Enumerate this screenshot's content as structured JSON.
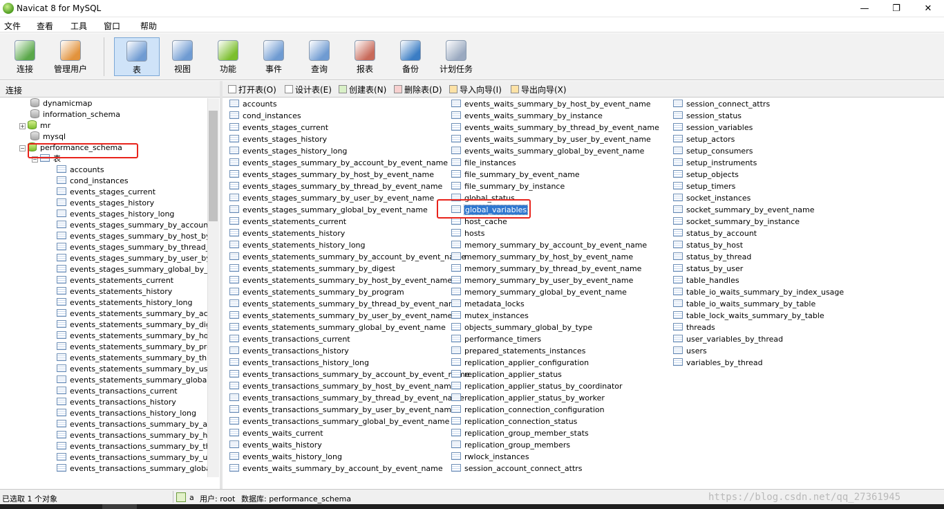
{
  "window": {
    "title": "Navicat 8 for MySQL",
    "min": "—",
    "max": "❐",
    "close": "✕"
  },
  "menu": [
    "文件",
    "查看",
    "工具",
    "窗口",
    "帮助"
  ],
  "toolbar": [
    {
      "label": "连接",
      "icon": "connection-icon",
      "color": "#5aa84a"
    },
    {
      "label": "管理用户",
      "icon": "user-icon",
      "color": "#e2933d"
    },
    {
      "label": "表",
      "icon": "table-icon",
      "color": "#6f9bd2",
      "active": true
    },
    {
      "label": "视图",
      "icon": "view-icon",
      "color": "#6f9bd2"
    },
    {
      "label": "功能",
      "icon": "function-icon",
      "color": "#7cbf2e"
    },
    {
      "label": "事件",
      "icon": "event-icon",
      "color": "#6f9bd2"
    },
    {
      "label": "查询",
      "icon": "query-icon",
      "color": "#6f9bd2"
    },
    {
      "label": "报表",
      "icon": "report-icon",
      "color": "#c86a5a"
    },
    {
      "label": "备份",
      "icon": "backup-icon",
      "color": "#3b7dc4"
    },
    {
      "label": "计划任务",
      "icon": "schedule-icon",
      "color": "#9aa9c0"
    }
  ],
  "left_panel": {
    "header": "连接",
    "databases": [
      {
        "name": "dynamicmap",
        "state": "closed"
      },
      {
        "name": "information_schema",
        "state": "closed"
      },
      {
        "name": "mr",
        "state": "open-collapsed"
      },
      {
        "name": "mysql",
        "state": "closed"
      },
      {
        "name": "performance_schema",
        "state": "open-expanded"
      }
    ],
    "group_label": "表",
    "tables": [
      "accounts",
      "cond_instances",
      "events_stages_current",
      "events_stages_history",
      "events_stages_history_long",
      "events_stages_summary_by_account_by",
      "events_stages_summary_by_host_by_ev",
      "events_stages_summary_by_thread_by_",
      "events_stages_summary_by_user_by_ev",
      "events_stages_summary_global_by_even",
      "events_statements_current",
      "events_statements_history",
      "events_statements_history_long",
      "events_statements_summary_by_accour",
      "events_statements_summary_by_digest",
      "events_statements_summary_by_host_b",
      "events_statements_summary_by_progra",
      "events_statements_summary_by_thread",
      "events_statements_summary_by_user_b",
      "events_statements_summary_global_by_",
      "events_transactions_current",
      "events_transactions_history",
      "events_transactions_history_long",
      "events_transactions_summary_by_accou",
      "events_transactions_summary_by_host_",
      "events_transactions_summary_by_threa",
      "events_transactions_summary_by_user_",
      "events_transactions_summary_global_by"
    ]
  },
  "right_toolbar": [
    {
      "label": "打开表(O)",
      "icon": "open-table-icon",
      "variant": ""
    },
    {
      "label": "设计表(E)",
      "icon": "design-table-icon",
      "variant": ""
    },
    {
      "label": "创建表(N)",
      "icon": "create-table-icon",
      "variant": "green"
    },
    {
      "label": "删除表(D)",
      "icon": "delete-table-icon",
      "variant": "red"
    },
    {
      "label": "导入向导(I)",
      "icon": "import-wizard-icon",
      "variant": "up"
    },
    {
      "label": "导出向导(X)",
      "icon": "export-wizard-icon",
      "variant": "down"
    }
  ],
  "tables": {
    "selected": "global_variables",
    "columns": [
      [
        "accounts",
        "cond_instances",
        "events_stages_current",
        "events_stages_history",
        "events_stages_history_long",
        "events_stages_summary_by_account_by_event_name",
        "events_stages_summary_by_host_by_event_name",
        "events_stages_summary_by_thread_by_event_name",
        "events_stages_summary_by_user_by_event_name",
        "events_stages_summary_global_by_event_name",
        "events_statements_current",
        "events_statements_history",
        "events_statements_history_long",
        "events_statements_summary_by_account_by_event_name",
        "events_statements_summary_by_digest",
        "events_statements_summary_by_host_by_event_name",
        "events_statements_summary_by_program",
        "events_statements_summary_by_thread_by_event_name",
        "events_statements_summary_by_user_by_event_name",
        "events_statements_summary_global_by_event_name",
        "events_transactions_current",
        "events_transactions_history",
        "events_transactions_history_long",
        "events_transactions_summary_by_account_by_event_name",
        "events_transactions_summary_by_host_by_event_name",
        "events_transactions_summary_by_thread_by_event_name",
        "events_transactions_summary_by_user_by_event_name",
        "events_transactions_summary_global_by_event_name",
        "events_waits_current",
        "events_waits_history",
        "events_waits_history_long",
        "events_waits_summary_by_account_by_event_name"
      ],
      [
        "events_waits_summary_by_host_by_event_name",
        "events_waits_summary_by_instance",
        "events_waits_summary_by_thread_by_event_name",
        "events_waits_summary_by_user_by_event_name",
        "events_waits_summary_global_by_event_name",
        "file_instances",
        "file_summary_by_event_name",
        "file_summary_by_instance",
        "global_status",
        "global_variables",
        "host_cache",
        "hosts",
        "memory_summary_by_account_by_event_name",
        "memory_summary_by_host_by_event_name",
        "memory_summary_by_thread_by_event_name",
        "memory_summary_by_user_by_event_name",
        "memory_summary_global_by_event_name",
        "metadata_locks",
        "mutex_instances",
        "objects_summary_global_by_type",
        "performance_timers",
        "prepared_statements_instances",
        "replication_applier_configuration",
        "replication_applier_status",
        "replication_applier_status_by_coordinator",
        "replication_applier_status_by_worker",
        "replication_connection_configuration",
        "replication_connection_status",
        "replication_group_member_stats",
        "replication_group_members",
        "rwlock_instances",
        "session_account_connect_attrs"
      ],
      [
        "session_connect_attrs",
        "session_status",
        "session_variables",
        "setup_actors",
        "setup_consumers",
        "setup_instruments",
        "setup_objects",
        "setup_timers",
        "socket_instances",
        "socket_summary_by_event_name",
        "socket_summary_by_instance",
        "status_by_account",
        "status_by_host",
        "status_by_thread",
        "status_by_user",
        "table_handles",
        "table_io_waits_summary_by_index_usage",
        "table_io_waits_summary_by_table",
        "table_lock_waits_summary_by_table",
        "threads",
        "user_variables_by_thread",
        "users",
        "variables_by_thread"
      ]
    ]
  },
  "status": {
    "selected_count": "已选取 1 个对象",
    "connection": "a",
    "user": "用户: root",
    "database": "数据库: performance_schema",
    "watermark": "https://blog.csdn.net/qq_27361945"
  }
}
